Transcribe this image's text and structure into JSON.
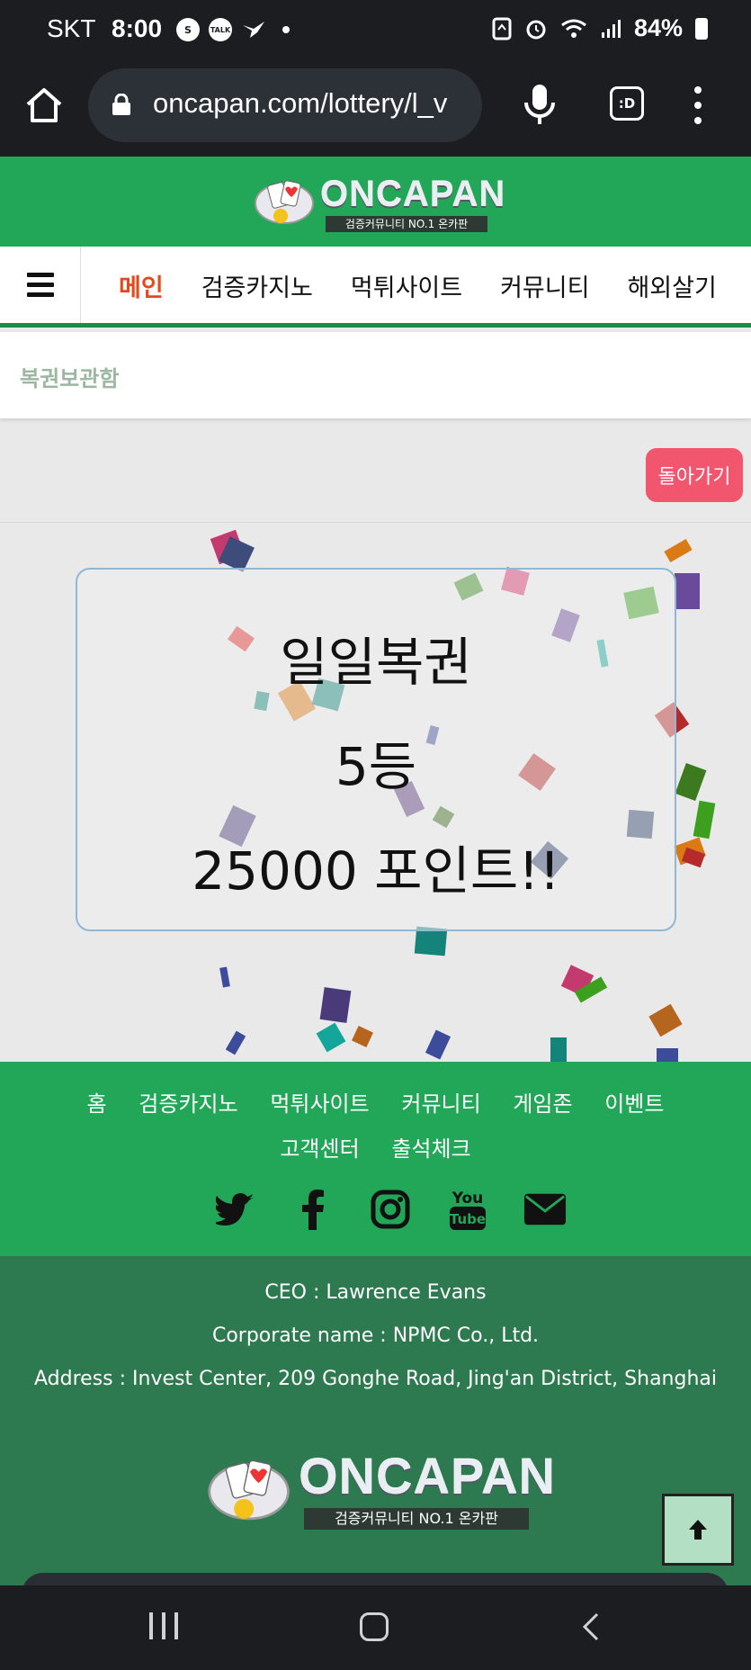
{
  "status_bar": {
    "carrier": "SKT",
    "time": "8:00",
    "notification_icons": [
      "s-icon",
      "talk-icon",
      "bird-icon"
    ],
    "battery": "84%"
  },
  "browser": {
    "url": "oncapan.com/lottery/l_v",
    "tabs_label": ":D"
  },
  "site": {
    "logo_text": "ONCAPAN",
    "logo_sub": "검증커뮤니티 NO.1 온카판",
    "nav": [
      "메인",
      "검증카지노",
      "먹튀사이트",
      "커뮤니티",
      "해외살기"
    ],
    "breadcrumb": "복권보관함",
    "back_button": "돌아가기"
  },
  "result": {
    "name": "일일복권",
    "rank": "5등",
    "prize": "25000 포인트!!"
  },
  "footer": {
    "links_row1": [
      "홈",
      "검증카지노",
      "먹튀사이트",
      "커뮤니티",
      "게임존",
      "이벤트"
    ],
    "links_row2": [
      "고객센터",
      "출석체크"
    ],
    "social_icons": [
      "twitter-icon",
      "facebook-icon",
      "instagram-icon",
      "youtube-icon",
      "mail-icon"
    ],
    "youtube_label": "You Tube",
    "ceo": "CEO : Lawrence Evans",
    "corporate": "Corporate name : NPMC Co., Ltd.",
    "address": "Address : Invest Center, 209 Gonghe Road, Jing'an District, Shanghai"
  },
  "colors": {
    "brand_green": "#22a758",
    "footer_dark_green": "#2e7a50",
    "active_nav": "#e4481b",
    "back_button": "#f2556e"
  }
}
